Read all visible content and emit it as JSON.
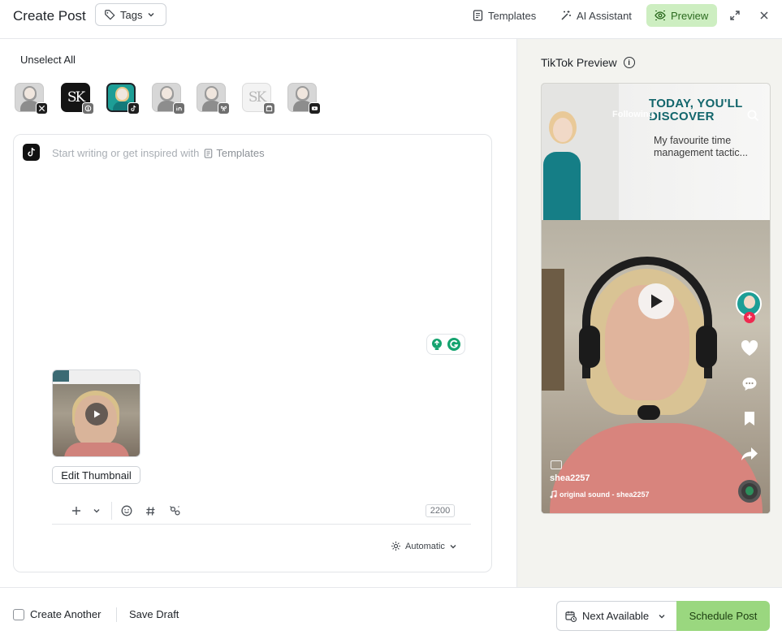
{
  "header": {
    "title": "Create Post",
    "tags_label": "Tags",
    "templates_label": "Templates",
    "ai_label": "AI Assistant",
    "preview_label": "Preview"
  },
  "accounts": {
    "unselect_label": "Unselect All",
    "items": [
      {
        "network": "X",
        "badge_icon": "x-icon",
        "selected": false
      },
      {
        "network": "Pinterest",
        "badge_icon": "pinterest-icon",
        "selected": false,
        "monogram": "SK"
      },
      {
        "network": "TikTok",
        "badge_icon": "tiktok-icon",
        "selected": true
      },
      {
        "network": "LinkedIn",
        "badge_icon": "linkedin-icon",
        "selected": false
      },
      {
        "network": "Bluesky",
        "badge_icon": "bluesky-icon",
        "selected": false
      },
      {
        "network": "Google Business",
        "badge_icon": "google-business-icon",
        "selected": false,
        "monogram": "SK"
      },
      {
        "network": "YouTube",
        "badge_icon": "youtube-icon",
        "selected": false
      }
    ]
  },
  "editor": {
    "placeholder": "Start writing or get inspired with",
    "templates_link": "Templates",
    "edit_thumbnail_label": "Edit Thumbnail",
    "char_count": "2200",
    "schedule_mode": "Automatic"
  },
  "footer": {
    "create_another_label": "Create Another",
    "save_draft_label": "Save Draft",
    "next_available_label": "Next Available",
    "schedule_label": "Schedule Post"
  },
  "preview": {
    "title": "TikTok Preview",
    "headline": "TODAY, YOU'LL DISCOVER",
    "subline": "My favourite time management tactic...",
    "following": "Following",
    "username": "shea2257",
    "sound": "original sound - shea2257"
  },
  "colors": {
    "accent_green": "#cdeec1",
    "schedule_green": "#9ad77f",
    "preview_bg": "#f3f3ef",
    "headline_teal": "#13666c",
    "like_red": "#ef2950"
  }
}
